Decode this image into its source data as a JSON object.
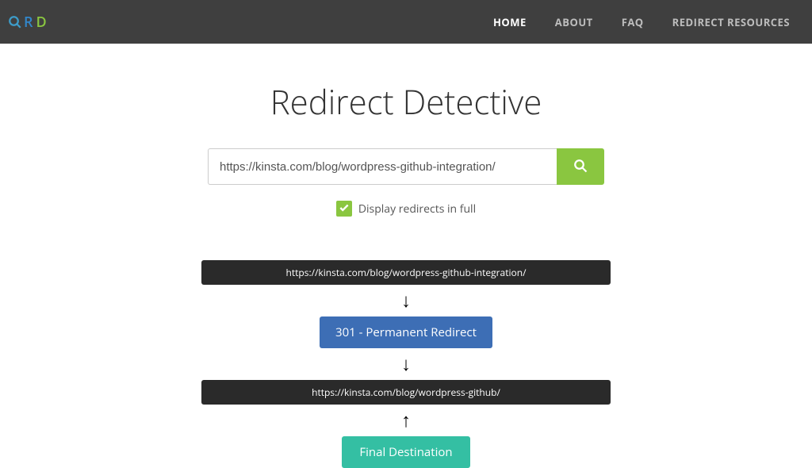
{
  "logo": {
    "letter_r": "R",
    "letter_d": "D"
  },
  "nav": {
    "home": "HOME",
    "about": "ABOUT",
    "faq": "FAQ",
    "resources": "REDIRECT RESOURCES"
  },
  "title": "Redirect Detective",
  "search": {
    "value": "https://kinsta.com/blog/wordpress-github-integration/"
  },
  "checkbox": {
    "label": "Display redirects in full"
  },
  "chain": {
    "url1": "https://kinsta.com/blog/wordpress-github-integration/",
    "redirect_label": "301 - Permanent Redirect",
    "url2": "https://kinsta.com/blog/wordpress-github/",
    "destination_label": "Final Destination"
  }
}
